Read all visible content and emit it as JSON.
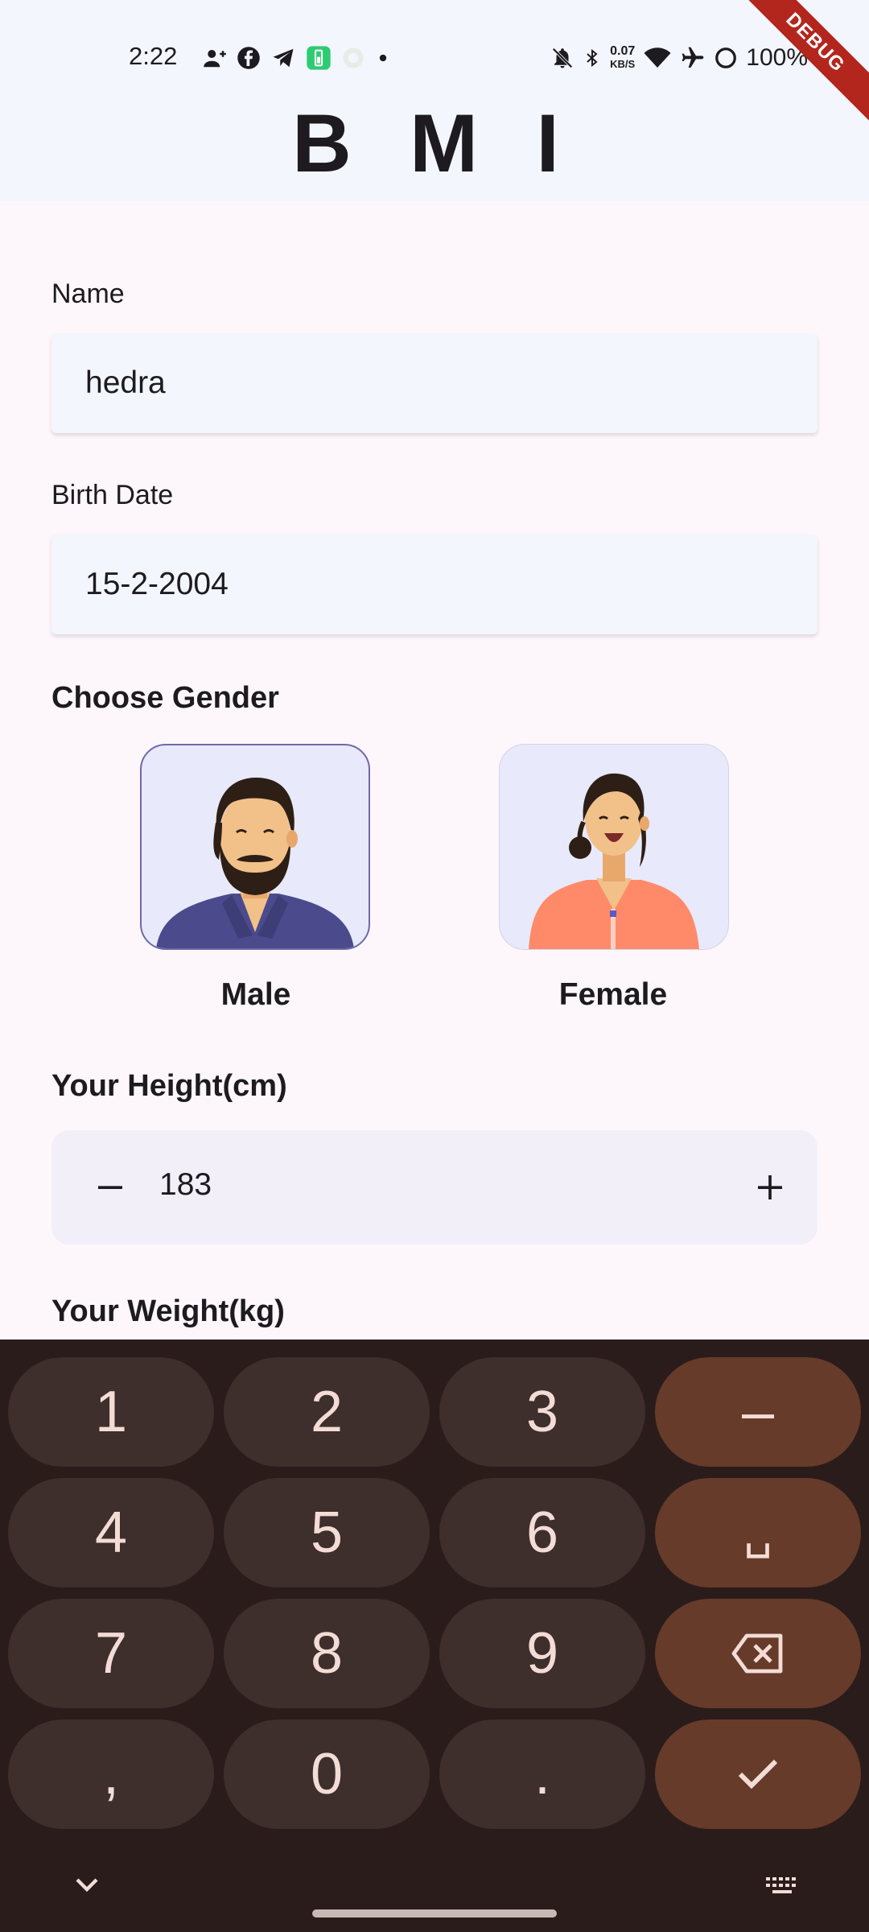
{
  "status_bar": {
    "time": "2:22",
    "net_speed_value": "0.07",
    "net_speed_unit": "KB/S",
    "battery": "100%",
    "debug_banner": "DEBUG",
    "left_icons": [
      "person-add-icon",
      "facebook-icon",
      "telegram-icon",
      "battery-app-icon",
      "app-icon",
      "dot-icon"
    ],
    "right_icons": [
      "mute-icon",
      "bluetooth-icon",
      "wifi-icon",
      "airplane-icon",
      "battery-ring-icon"
    ]
  },
  "app": {
    "title": "B M I"
  },
  "form": {
    "name_label": "Name",
    "name_value": "hedra",
    "birth_label": "Birth Date",
    "birth_value": "15-2-2004",
    "gender_label": "Choose Gender",
    "genders": [
      {
        "label": "Male",
        "selected": true
      },
      {
        "label": "Female",
        "selected": false
      }
    ],
    "height_label": "Your Height(cm)",
    "height_value": "183",
    "weight_label": "Your Weight(kg)"
  },
  "keyboard": {
    "keys": [
      [
        "1",
        "2",
        "3",
        "–"
      ],
      [
        "4",
        "5",
        "6",
        "␣"
      ],
      [
        "7",
        "8",
        "9",
        "backspace"
      ],
      [
        ",",
        "0",
        ".",
        "done"
      ]
    ]
  },
  "colors": {
    "accent_border": "#6e6aa8",
    "keyboard_bg": "#2a1c1b",
    "key_bg": "#3e2e2c",
    "func_key_bg": "#663b2a",
    "male_shirt": "#4a4a8c",
    "female_shirt": "#ff8a6a"
  }
}
